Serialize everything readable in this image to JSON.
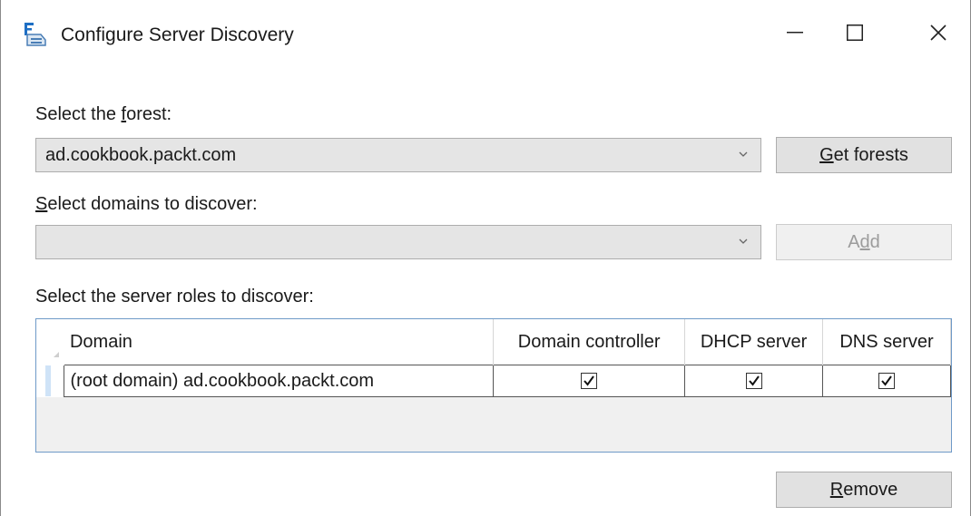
{
  "window": {
    "title": "Configure Server Discovery",
    "icon": "server-discovery-icon",
    "controls": [
      "minimize-icon",
      "maximize-icon",
      "close-icon"
    ]
  },
  "forest": {
    "label_pre": "Select the ",
    "label_accel": "f",
    "label_post": "orest:",
    "selected": "ad.cookbook.packt.com",
    "get_forests_accel": "G",
    "get_forests_rest": "et forests"
  },
  "domains": {
    "label_accel": "S",
    "label_post": "elect domains to discover:",
    "selected": "",
    "add_pre": "A",
    "add_accel": "d",
    "add_post": "d"
  },
  "roles": {
    "label": "Select the server roles to discover:",
    "columns": [
      "Domain",
      "Domain controller",
      "DHCP server",
      "DNS server"
    ],
    "rows": [
      {
        "domain": "(root domain) ad.cookbook.packt.com",
        "domain_controller": true,
        "dhcp_server": true,
        "dns_server": true
      }
    ]
  },
  "remove": {
    "accel": "R",
    "rest": "emove"
  }
}
